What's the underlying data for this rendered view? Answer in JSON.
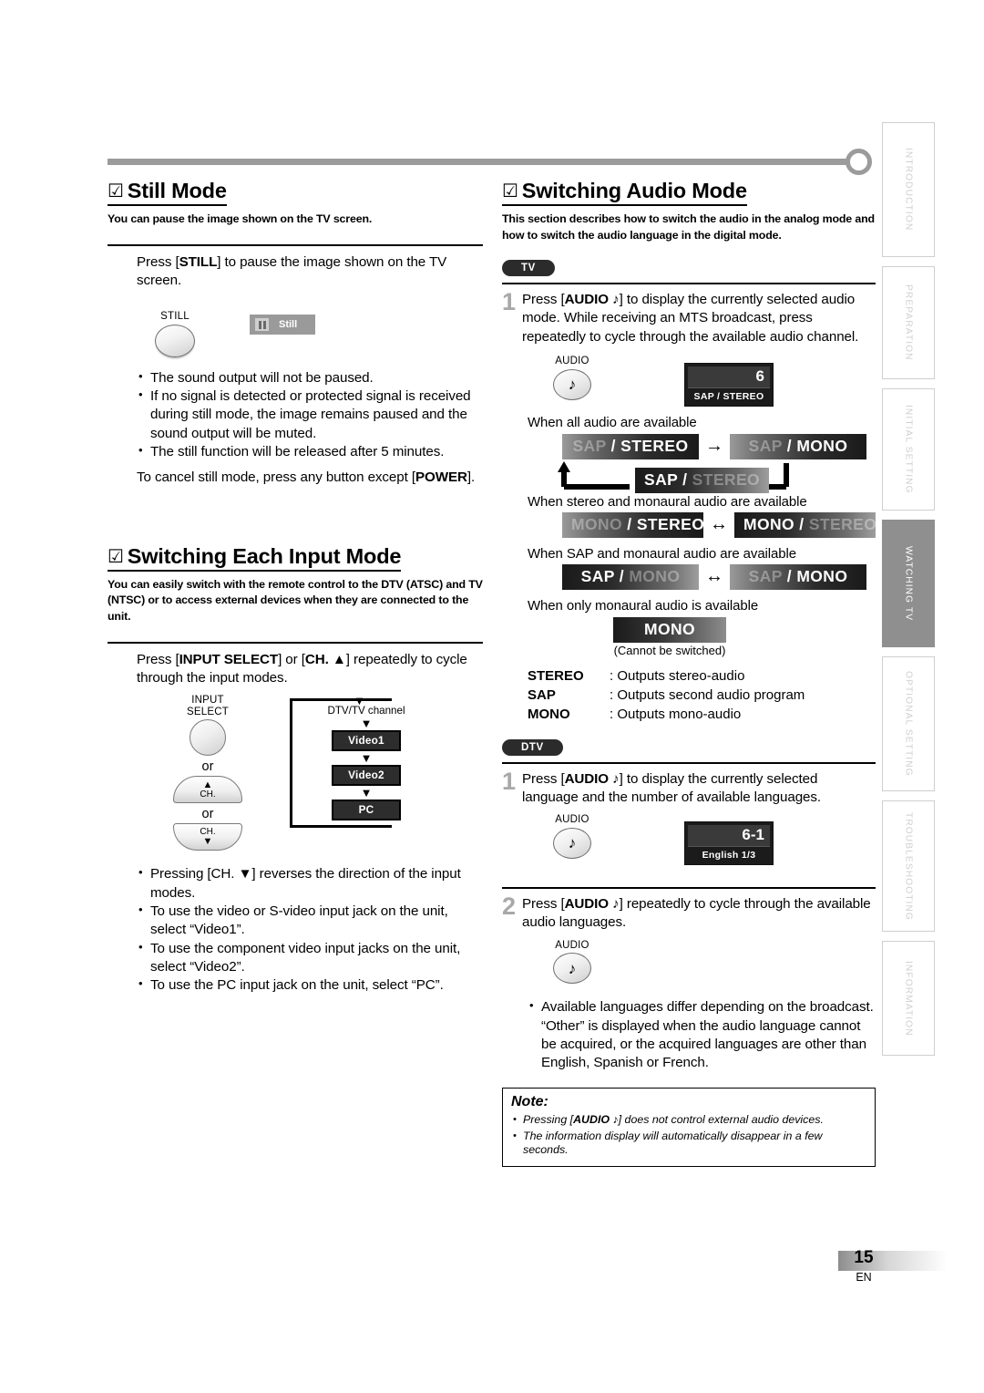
{
  "page": {
    "number": "15",
    "language_code": "EN"
  },
  "side_tabs": [
    {
      "label": "INTRODUCTION",
      "active": false
    },
    {
      "label": "PREPARATION",
      "active": false
    },
    {
      "label": "INITIAL  SETTING",
      "active": false
    },
    {
      "label": "WATCHING  TV",
      "active": true
    },
    {
      "label": "OPTIONAL  SETTING",
      "active": false
    },
    {
      "label": "TROUBLESHOOTING",
      "active": false
    },
    {
      "label": "INFORMATION",
      "active": false
    }
  ],
  "still_mode": {
    "check": "☑",
    "heading": "Still Mode",
    "subheading": "You can pause the image shown on the TV screen.",
    "instruction_prefix": "Press [",
    "instruction_key": "STILL",
    "instruction_suffix": "] to pause the image shown on the TV screen.",
    "button_label": "STILL",
    "osd_label": "Still",
    "bullets": [
      "The sound output will not be paused.",
      "If no signal is detected or protected signal is received during still mode, the image remains paused and the sound output will be muted.",
      "The still function will be released after 5 minutes."
    ],
    "cancel_prefix": "To cancel still mode, press any button except [",
    "cancel_key": "POWER",
    "cancel_suffix": "]."
  },
  "switching_input": {
    "check": "☑",
    "heading": "Switching Each Input Mode",
    "subheading": "You can easily switch with the remote control to the DTV (ATSC) and TV (NTSC) or to access external devices when they are connected to the unit.",
    "instruction_parts": {
      "p1": "Press [",
      "k1": "INPUT SELECT",
      "p2": "] or [",
      "k2": "CH. ▲",
      "p3": "] repeatedly to cycle through the input modes."
    },
    "button_input_select_line1": "INPUT",
    "button_input_select_line2": "SELECT",
    "or_label": "or",
    "ch_up_label": "CH.",
    "ch_down_label": "CH.",
    "flow": {
      "top": "DTV/TV channel",
      "items": [
        "Video1",
        "Video2",
        "PC"
      ]
    },
    "bullets": [
      "Pressing [CH. ▼] reverses the direction of the input modes.",
      "To use the video or S-video input jack on the unit, select “Video1”.",
      "To use the component video input jacks on the unit, select “Video2”.",
      "To use the PC input jack on the unit, select “PC”."
    ]
  },
  "switching_audio": {
    "check": "☑",
    "heading": "Switching Audio Mode",
    "subheading": "This section describes how to switch the audio in the analog mode and how to switch the audio language in the digital mode.",
    "tv_pill": "TV",
    "dtv_pill": "DTV",
    "tv_step1": {
      "num": "1",
      "p1": "Press [",
      "k1": "AUDIO ♪",
      "p2": "] to display the currently selected audio mode. While receiving an MTS broadcast, press repeatedly to cycle through the available audio channel."
    },
    "audio_button_label": "AUDIO",
    "audio_button_glyph": "♪",
    "tv_osd": {
      "number": "6",
      "sub": "SAP / STEREO"
    },
    "case_all": "When all audio are available",
    "case_stereo_mono": "When stereo and monaural audio are available",
    "case_sap_mono": "When SAP and monaural audio are available",
    "case_mono_only": "When only monaural audio is available",
    "chips": {
      "sap_stereo_active_right": {
        "left": "SAP",
        "sep": " / ",
        "right": "STEREO",
        "dim": "left"
      },
      "sap_mono_active_right": {
        "left": "SAP",
        "sep": " / ",
        "right": "MONO",
        "dim": "left"
      },
      "sap_stereo_active_left": {
        "left": "SAP",
        "sep": " / ",
        "right": "STEREO",
        "dim": "right"
      },
      "mono_stereo_active_right": {
        "left": "MONO",
        "sep": " / ",
        "right": "STEREO",
        "dim": "left"
      },
      "mono_stereo_active_left": {
        "left": "MONO",
        "sep": " / ",
        "right": "STEREO",
        "dim": "right"
      },
      "sap_mono_active_left": {
        "left": "SAP",
        "sep": " / ",
        "right": "MONO",
        "dim": "right"
      },
      "sap_mono_active_right2": {
        "left": "SAP",
        "sep": " / ",
        "right": "MONO",
        "dim": "left"
      },
      "mono_only": "MONO"
    },
    "arrow_single": "→",
    "arrow_double": "↔",
    "cannot_switch": "(Cannot be switched)",
    "definitions": [
      {
        "term": "STEREO",
        "desc": ": Outputs stereo-audio"
      },
      {
        "term": "SAP",
        "desc": ": Outputs second audio program"
      },
      {
        "term": "MONO",
        "desc": ": Outputs mono-audio"
      }
    ],
    "dtv_step1": {
      "num": "1",
      "p1": "Press [",
      "k1": "AUDIO ♪",
      "p2": "] to display the currently selected language and the number of available languages."
    },
    "dtv_osd": {
      "number": "6-1",
      "sub": "English 1/3"
    },
    "dtv_step2": {
      "num": "2",
      "p1": "Press [",
      "k1": "AUDIO ♪",
      "p2": "] repeatedly to cycle through the available audio languages."
    },
    "dtv_bullet": "Available languages differ depending on the broadcast. “Other” is displayed when the audio language cannot be acquired, or the acquired languages are other than English, Spanish or French.",
    "note": {
      "title": "Note:",
      "items_pre": [
        "Pressing [",
        ""
      ],
      "item1_p1": "Pressing [",
      "item1_k": "AUDIO ♪",
      "item1_p2": "] does not control external audio devices.",
      "item2": "The information display will automatically disappear in a few seconds."
    }
  }
}
